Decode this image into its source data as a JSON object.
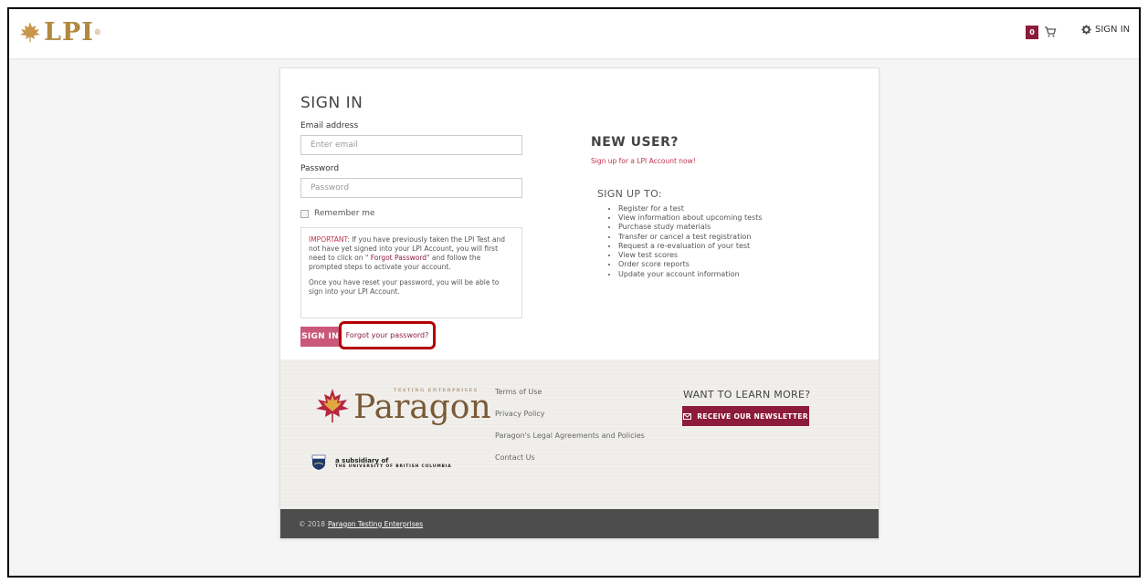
{
  "header": {
    "logo_text": "LPI",
    "logo_mark": "®",
    "cart_count": "0",
    "signin_label": "SIGN IN",
    "accent_color": "#8c1c3a"
  },
  "signin": {
    "title": "SIGN IN",
    "email_label": "Email address",
    "email_placeholder": "Enter email",
    "password_label": "Password",
    "password_placeholder": "Password",
    "remember_label": "Remember me",
    "notice": {
      "important_label": "IMPORTANT",
      "text_before_link": ": If you have previously taken the LPI Test and not have yet signed into your LPI Account, you will first need to click on \" ",
      "link_text": "Forgot Password",
      "text_after_link": "\" and follow the prompted steps to activate your account.",
      "paragraph2": "Once you have reset your password, you will be able to sign into your LPI Account."
    },
    "submit_label": "SIGN IN",
    "forgot_label": "Forgot your password?"
  },
  "new_user": {
    "title": "NEW USER?",
    "signup_link": "Sign up for a LPI Account now!",
    "signup_to": "SIGN UP TO:",
    "benefits": [
      "Register for a test",
      "View information about upcoming tests",
      "Purchase study materials",
      "Transfer or cancel a test registration",
      "Request a re-evaluation of your test",
      "View test scores",
      "Order score reports",
      "Update your account information"
    ]
  },
  "footer": {
    "brand_sub": "TESTING ENTERPRISES",
    "brand_name": "Paragon",
    "subsidiary_line1": "a subsidiary of",
    "subsidiary_line2": "THE UNIVERSITY OF BRITISH COLUMBIA",
    "links": [
      "Terms of Use",
      "Privacy Policy",
      "Paragon's Legal Agreements and Policies",
      "Contact Us"
    ],
    "learn_title": "WANT TO LEARN MORE?",
    "newsletter_label": "RECEIVE OUR NEWSLETTER",
    "copyright_prefix": "© 2018",
    "copyright_link": "Paragon Testing Enterprises"
  }
}
